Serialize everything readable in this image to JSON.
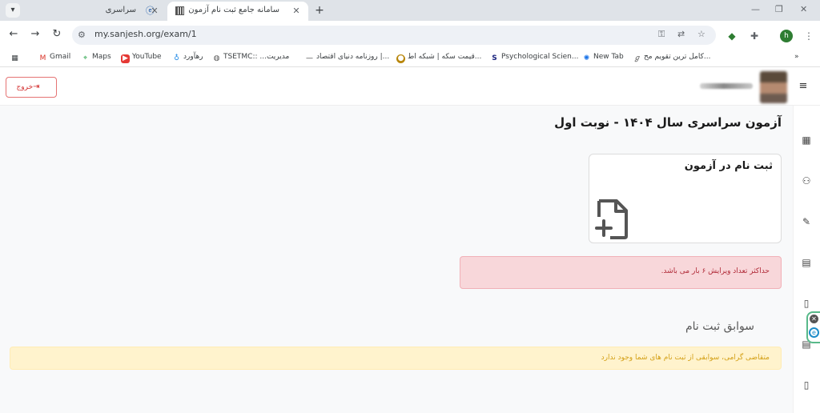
{
  "browser": {
    "tabs": [
      {
        "title": "سراسری",
        "active": false
      },
      {
        "title": "سامانه جامع ثبت نام آزمون های ...",
        "active": true
      }
    ],
    "url": "my.sanjesh.org/exam/1",
    "profile_initial": "h"
  },
  "bookmarks": [
    {
      "label": "Gmail",
      "icon": "gmail-icon"
    },
    {
      "label": "Maps",
      "icon": "maps-icon"
    },
    {
      "label": "YouTube",
      "icon": "youtube-icon"
    },
    {
      "label": "رهآورد",
      "icon": "pin-icon"
    },
    {
      "label": "TSETMC:: ...مدیریت",
      "icon": "globe-icon"
    },
    {
      "label": "روزنامه دنیای اقتصاد |...",
      "icon": "dash-icon"
    },
    {
      "label": "قیمت سکه | شبکه اط...",
      "icon": "coin-icon"
    },
    {
      "label": "Psychological Scien...",
      "icon": "s-icon"
    },
    {
      "label": "New Tab",
      "icon": "newtab-icon"
    },
    {
      "label": "کامل ترین تقویم مح...",
      "icon": "g-icon"
    }
  ],
  "header": {
    "logout_label": "خروج"
  },
  "main": {
    "page_title": "آزمون سراسری سال ۱۴۰۴ - نوبت اول",
    "register_card_title": "ثبت نام در آزمون",
    "edit_limit_alert": "حداکثر تعداد ویرایش ۶ بار می باشد.",
    "history_title": "سوابق ثبت نام",
    "history_empty_alert": "متقاضی گرامی، سوابقی از ثبت نام های شما وجود ندارد"
  },
  "colors": {
    "danger_bg": "#f8d7da",
    "danger_text": "#b02a37",
    "warning_bg": "#fff3cd",
    "warning_text": "#d4a017",
    "logout_border": "#e57373"
  }
}
